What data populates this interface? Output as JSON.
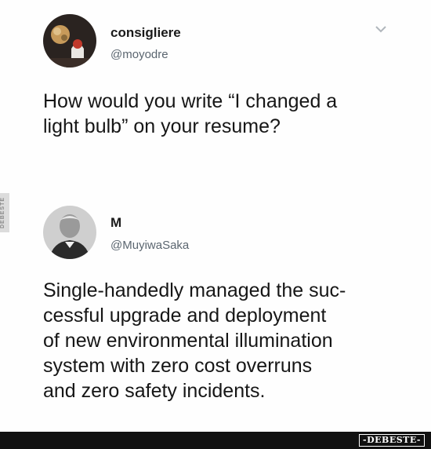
{
  "tweet": {
    "author_name": "consigliere",
    "author_handle": "@moyodre",
    "text": "How would you write “I changed a\nlight bulb” on your resume?",
    "menu_icon": "chevron-down-icon"
  },
  "reply": {
    "author_name": "M",
    "author_handle": "@MuyiwaSaka",
    "text": "Single-handedly managed the suc-\ncessful upgrade and deployment\nof new environmental illumination\nsystem with zero cost overruns\nand zero safety incidents."
  },
  "watermarks": {
    "side_label": "DEBESTE",
    "bottom_badge": "-DEBESTE-"
  },
  "colors": {
    "handle": "#5b6670",
    "text": "#161616",
    "bar": "#111111"
  }
}
